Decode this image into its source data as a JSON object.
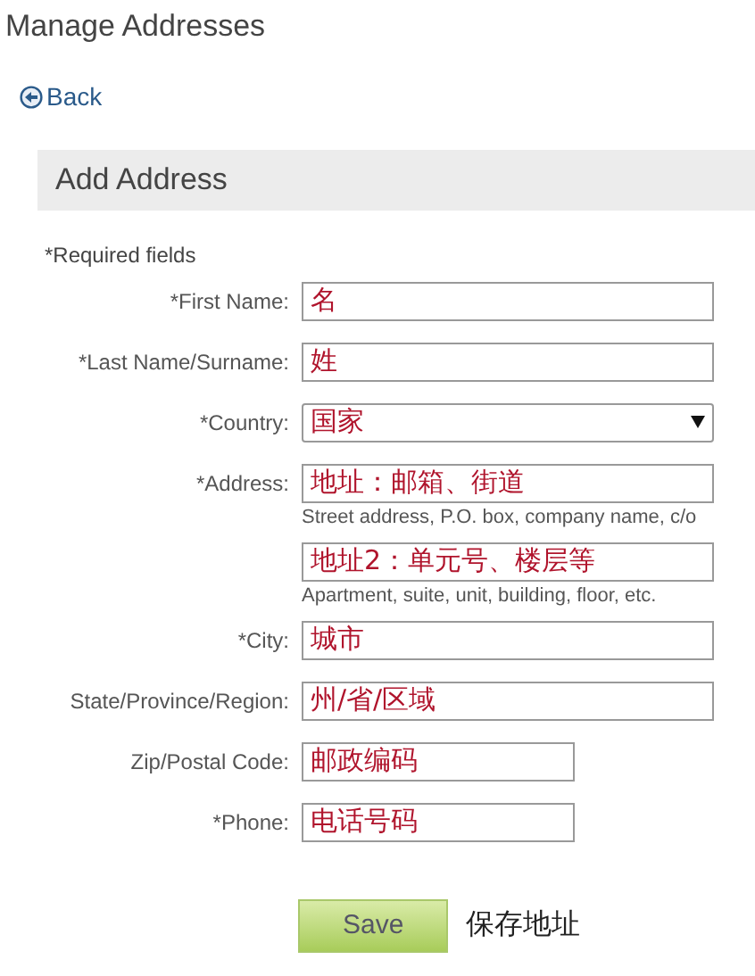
{
  "page_title": "Manage Addresses",
  "back_link": "Back",
  "section_title": "Add Address",
  "required_note": "*Required fields",
  "fields": [
    {
      "kind": "text",
      "label": "*First Name:",
      "value": "名"
    },
    {
      "kind": "text",
      "label": "*Last Name/Surname:",
      "value": "姓"
    },
    {
      "kind": "select",
      "label": "*Country:",
      "value": "国家"
    },
    {
      "kind": "text",
      "label": "*Address:",
      "value": "地址：邮箱、街道",
      "note": "Street address, P.O. box, company name, c/o"
    },
    {
      "kind": "text",
      "value": "地址2：单元号、楼层等",
      "note": "Apartment, suite, unit, building, floor, etc."
    },
    {
      "kind": "text",
      "label": "*City:",
      "value": "城市"
    },
    {
      "kind": "text",
      "label": "State/Province/Region:",
      "value": "州/省/区域"
    },
    {
      "kind": "short",
      "label": "Zip/Postal Code:",
      "value": "邮政编码"
    },
    {
      "kind": "short",
      "label": "*Phone:",
      "value": "电话号码"
    }
  ],
  "save_button": "Save",
  "save_annotation": "保存地址"
}
